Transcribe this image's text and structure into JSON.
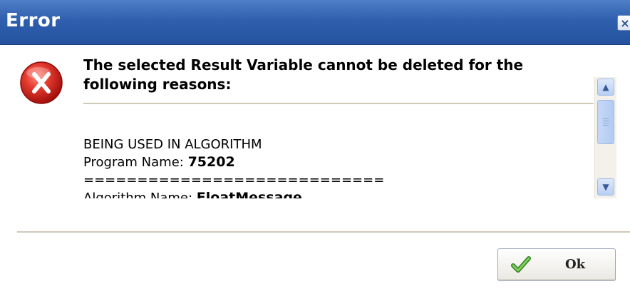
{
  "dialog": {
    "title": "Error",
    "close_glyph": "×",
    "icon": "error-x-icon"
  },
  "message": {
    "heading": "The selected Result Variable cannot be deleted for the following reasons:",
    "reason": "BEING USED IN ALGORITHM",
    "program_label": "Program Name: ",
    "program_value": "75202",
    "separator": "============================",
    "algorithm_label": "Algorithm Name: ",
    "algorithm_value": "FloatMessage"
  },
  "scrollbar": {
    "up_glyph": "▲",
    "down_glyph": "▼"
  },
  "buttons": {
    "ok_label": "Ok",
    "ok_icon": "checkmark-icon"
  },
  "colors": {
    "titlebar": "#2f5fae",
    "error_red": "#d8262b",
    "check_green": "#3f9c2a"
  }
}
